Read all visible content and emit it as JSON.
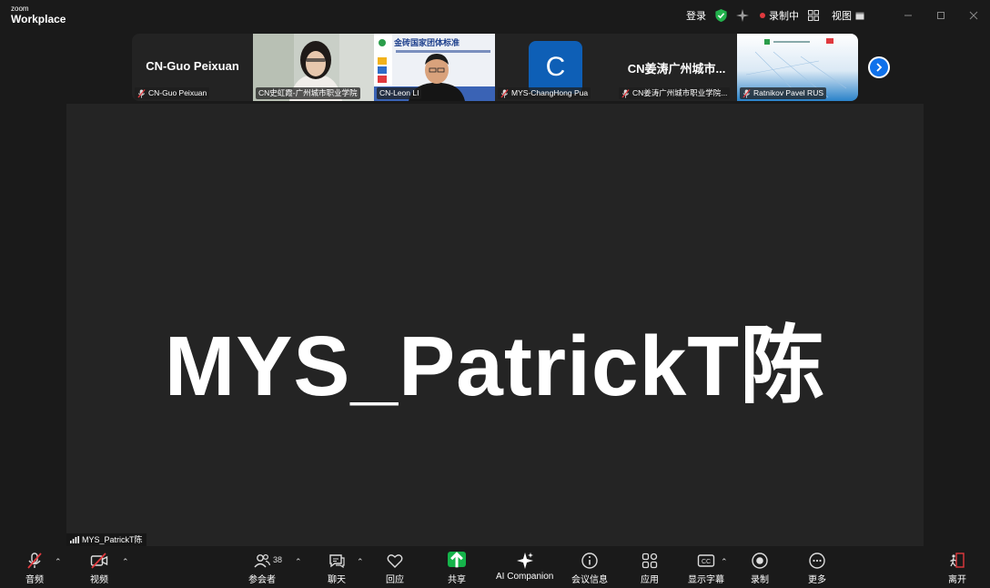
{
  "app": {
    "brand_top": "zoom",
    "brand_bottom": "Workplace"
  },
  "titlebar": {
    "login": "登录",
    "recording": "录制中",
    "view": "视图"
  },
  "filmstrip": [
    {
      "big_name": "CN-Guo Peixuan",
      "label": "CN-Guo Peixuan",
      "muted": true
    },
    {
      "label": "CN史虹霞-广州城市职业学院",
      "muted": false
    },
    {
      "label": "CN-Leon LI",
      "muted": false
    },
    {
      "avatar_letter": "C",
      "label": "MYS-ChangHong Pua",
      "muted": true
    },
    {
      "big_name": "CN姜涛广州城市...",
      "label": "CN姜涛广州城市职业学院...",
      "muted": true
    },
    {
      "label": "Ratnikov Pavel RUS",
      "muted": true
    }
  ],
  "slide": {
    "title": "金砖国家团体标准"
  },
  "main": {
    "speaker_name": "MYS_PatrickT陈",
    "label": "MYS_PatrickT陈"
  },
  "toolbar": {
    "audio": "音频",
    "video": "视频",
    "participants": "参会者",
    "participants_count": "38",
    "chat": "聊天",
    "react": "回应",
    "share": "共享",
    "ai": "AI Companion",
    "info": "会议信息",
    "apps": "应用",
    "captions": "显示字幕",
    "record": "录制",
    "more": "更多",
    "leave": "离开"
  },
  "colors": {
    "accent_blue": "#0e71eb",
    "share_green": "#15b34a",
    "recording_red": "#e0393e",
    "shield_green": "#22b14c"
  }
}
